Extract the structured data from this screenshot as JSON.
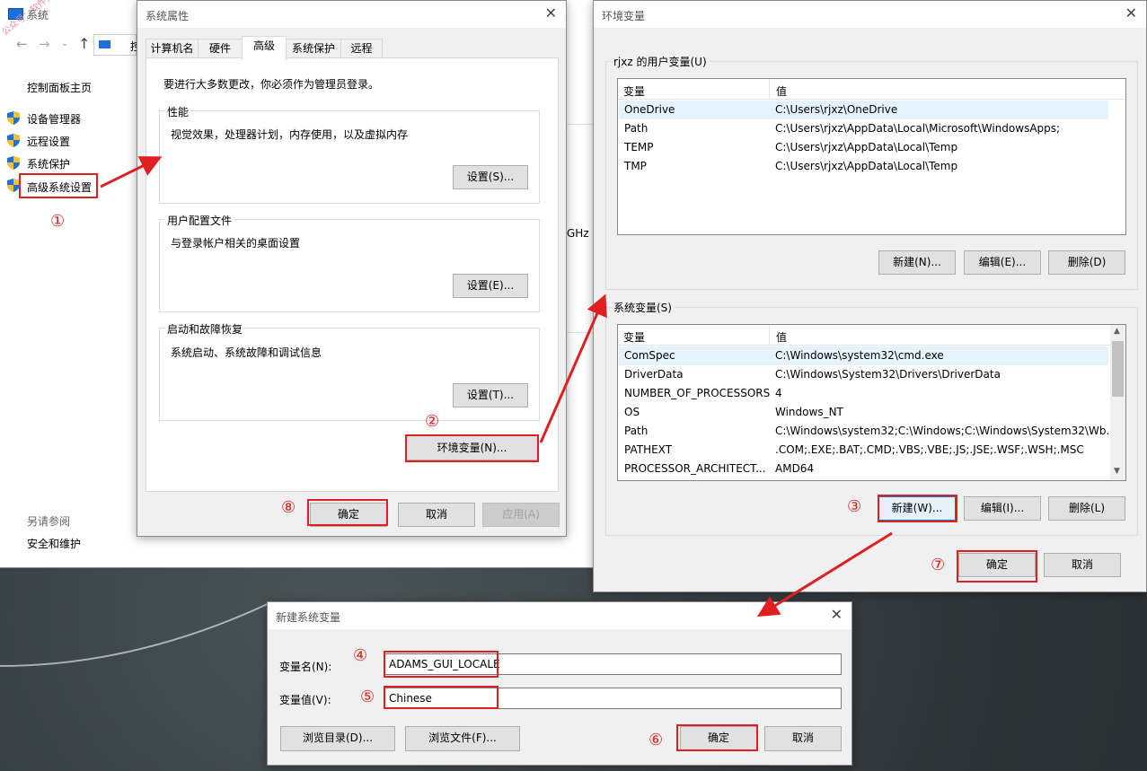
{
  "system_window": {
    "title": "系统",
    "watermark": "公众号：软件分享",
    "address_fragment": "控",
    "sidebar": {
      "home_label": "控制面板主页",
      "items": [
        "设备管理器",
        "远程设置",
        "系统保护",
        "高级系统设置"
      ],
      "see_also_label": "另请参阅",
      "see_also_items": [
        "安全和维护"
      ]
    },
    "ghz_fragment": "GHz"
  },
  "sys_props": {
    "title": "系统属性",
    "tabs": [
      "计算机名",
      "硬件",
      "高级",
      "系统保护",
      "远程"
    ],
    "active_tab": "高级",
    "admin_note": "要进行大多数更改，你必须作为管理员登录。",
    "groups": [
      {
        "label": "性能",
        "desc": "视觉效果，处理器计划，内存使用，以及虚拟内存",
        "button": "设置(S)..."
      },
      {
        "label": "用户配置文件",
        "desc": "与登录帐户相关的桌面设置",
        "button": "设置(E)..."
      },
      {
        "label": "启动和故障恢复",
        "desc": "系统启动、系统故障和调试信息",
        "button": "设置(T)..."
      }
    ],
    "env_button": "环境变量(N)...",
    "ok": "确定",
    "cancel": "取消",
    "apply": "应用(A)"
  },
  "env_vars": {
    "title": "环境变量",
    "user_group_label": "rjxz 的用户变量(U)",
    "col_var": "变量",
    "col_val": "值",
    "user_rows": [
      {
        "name": "OneDrive",
        "value": "C:\\Users\\rjxz\\OneDrive"
      },
      {
        "name": "Path",
        "value": "C:\\Users\\rjxz\\AppData\\Local\\Microsoft\\WindowsApps;"
      },
      {
        "name": "TEMP",
        "value": "C:\\Users\\rjxz\\AppData\\Local\\Temp"
      },
      {
        "name": "TMP",
        "value": "C:\\Users\\rjxz\\AppData\\Local\\Temp"
      }
    ],
    "user_buttons": {
      "new": "新建(N)...",
      "edit": "编辑(E)...",
      "delete": "删除(D)"
    },
    "sys_group_label": "系统变量(S)",
    "sys_rows": [
      {
        "name": "ComSpec",
        "value": "C:\\Windows\\system32\\cmd.exe"
      },
      {
        "name": "DriverData",
        "value": "C:\\Windows\\System32\\Drivers\\DriverData"
      },
      {
        "name": "NUMBER_OF_PROCESSORS",
        "value": "4"
      },
      {
        "name": "OS",
        "value": "Windows_NT"
      },
      {
        "name": "Path",
        "value": "C:\\Windows\\system32;C:\\Windows;C:\\Windows\\System32\\Wb..."
      },
      {
        "name": "PATHEXT",
        "value": ".COM;.EXE;.BAT;.CMD;.VBS;.VBE;.JS;.JSE;.WSF;.WSH;.MSC"
      },
      {
        "name": "PROCESSOR_ARCHITECT...",
        "value": "AMD64"
      }
    ],
    "sys_buttons": {
      "new": "新建(W)...",
      "edit": "编辑(I)...",
      "delete": "删除(L)"
    },
    "ok": "确定",
    "cancel": "取消"
  },
  "new_var": {
    "title": "新建系统变量",
    "name_label": "变量名(N):",
    "name_value": "ADAMS_GUI_LOCALE",
    "value_label": "变量值(V):",
    "value_value": "Chinese",
    "browse_dir": "浏览目录(D)...",
    "browse_file": "浏览文件(F)...",
    "ok": "确定",
    "cancel": "取消"
  },
  "steps": [
    "①",
    "②",
    "③",
    "④",
    "⑤",
    "⑥",
    "⑦",
    "⑧"
  ],
  "colors": {
    "annotation_red": "#e02020",
    "selection": "#e5f3ff",
    "icon_blue": "#1e6fd9",
    "shield_yellow": "#f2c12e"
  }
}
